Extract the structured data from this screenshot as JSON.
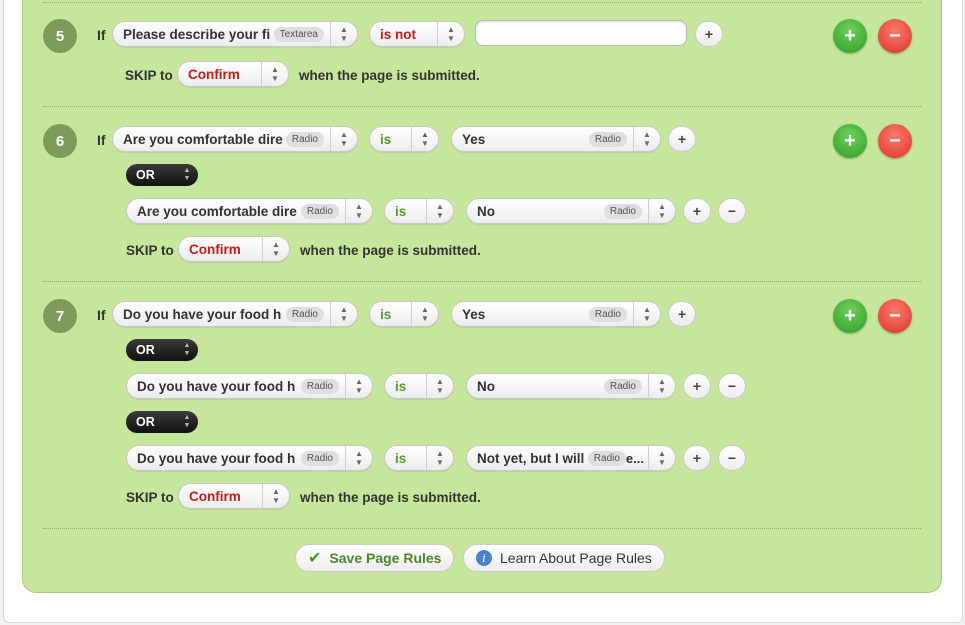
{
  "rules": [
    {
      "number": "5",
      "if_label": "If",
      "conditions": [
        {
          "field": "Please describe your fi",
          "field_type": "Textarea",
          "operator": "is not",
          "value": "",
          "value_kind": "text"
        }
      ],
      "skip_label": "SKIP to",
      "skip_target": "Confirm",
      "submitted_text": "when the page is submitted."
    },
    {
      "number": "6",
      "if_label": "If",
      "conditions": [
        {
          "field": "Are you comfortable dire",
          "field_type": "Radio",
          "operator": "is",
          "value": "Yes",
          "value_type": "Radio"
        },
        {
          "connector": "OR",
          "field": "Are you comfortable dire",
          "field_type": "Radio",
          "operator": "is",
          "value": "No",
          "value_type": "Radio"
        }
      ],
      "skip_label": "SKIP to",
      "skip_target": "Confirm",
      "submitted_text": "when the page is submitted."
    },
    {
      "number": "7",
      "if_label": "If",
      "conditions": [
        {
          "field": "Do you have your food h",
          "field_type": "Radio",
          "operator": "is",
          "value": "Yes",
          "value_type": "Radio"
        },
        {
          "connector": "OR",
          "field": "Do you have your food h",
          "field_type": "Radio",
          "operator": "is",
          "value": "No",
          "value_type": "Radio"
        },
        {
          "connector": "OR",
          "field": "Do you have your food h",
          "field_type": "Radio",
          "operator": "is",
          "value": "Not yet, but I will in",
          "value_type": "Radio",
          "value_suffix": "e..."
        }
      ],
      "skip_label": "SKIP to",
      "skip_target": "Confirm",
      "submitted_text": "when the page is submitted."
    }
  ],
  "buttons": {
    "plus": "+",
    "minus": "−",
    "save": "Save Page Rules",
    "learn": "Learn About Page Rules",
    "add_icon": "plus-icon",
    "delete_icon": "minus-icon",
    "save_icon": "checkmark-icon",
    "learn_icon": "info-icon"
  },
  "colors": {
    "panel": "#c6e69b",
    "accent_red": "#c81c1c",
    "accent_green": "#5a9a2a",
    "add_button": "#3fae33",
    "delete_button": "#e2443a"
  }
}
